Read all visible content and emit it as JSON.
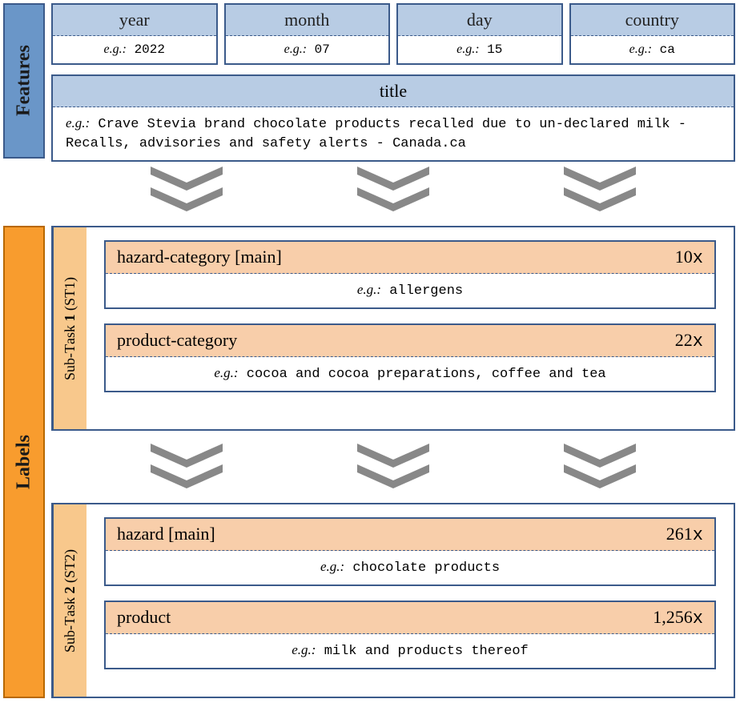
{
  "sections": {
    "features": "Features",
    "labels": "Labels"
  },
  "features": {
    "year": {
      "name": "year",
      "example": "2022"
    },
    "month": {
      "name": "month",
      "example": "07"
    },
    "day": {
      "name": "day",
      "example": "15"
    },
    "country": {
      "name": "country",
      "example": "ca"
    },
    "title": {
      "name": "title",
      "example": "Crave Stevia brand chocolate products recalled due to un-declared milk - Recalls, advisories and safety alerts - Canada.ca"
    }
  },
  "eg_prefix": "e.g.:",
  "subtasks": {
    "st1": {
      "label_html": "Sub-Task 1 (ST1)",
      "items": [
        {
          "name": "hazard-category [main]",
          "count": "10",
          "example": "allergens"
        },
        {
          "name": "product-category",
          "count": "22",
          "example": "cocoa and cocoa preparations, coffee and tea"
        }
      ]
    },
    "st2": {
      "label_html": "Sub-Task 2 (ST2)",
      "items": [
        {
          "name": "hazard [main]",
          "count": "261",
          "example": "chocolate products"
        },
        {
          "name": "product",
          "count": "1,256",
          "example": "milk and products thereof"
        }
      ]
    }
  },
  "x_suffix": "x"
}
